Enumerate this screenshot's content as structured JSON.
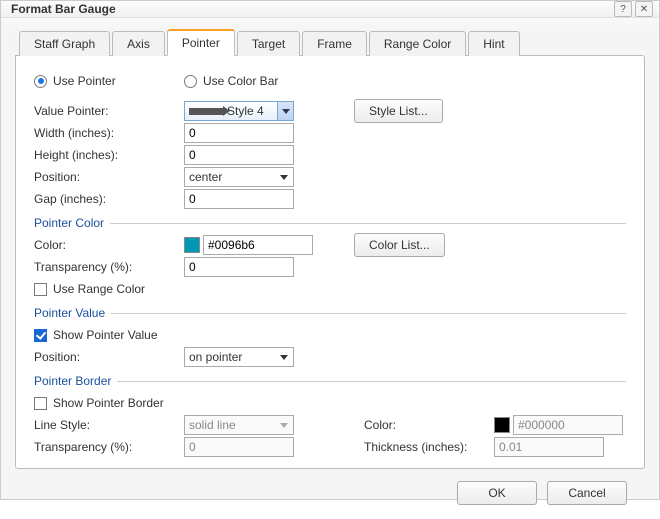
{
  "title": "Format Bar Gauge",
  "tabs": [
    "Staff Graph",
    "Axis",
    "Pointer",
    "Target",
    "Frame",
    "Range Color",
    "Hint"
  ],
  "activeTab": 2,
  "radio": {
    "usePointer": "Use Pointer",
    "useColorBar": "Use Color Bar"
  },
  "labels": {
    "valuePointer": "Value Pointer:",
    "width": "Width (inches):",
    "height": "Height (inches):",
    "position": "Position:",
    "gap": "Gap (inches):",
    "color": "Color:",
    "transparency": "Transparency (%):",
    "useRangeColor": "Use Range Color",
    "showPointerValue": "Show Pointer Value",
    "showPointerBorder": "Show Pointer Border",
    "lineStyle": "Line Style:",
    "thickness": "Thickness (inches):"
  },
  "sections": {
    "pointerColor": "Pointer Color",
    "pointerValue": "Pointer Value",
    "pointerBorder": "Pointer Border"
  },
  "buttons": {
    "styleList": "Style List...",
    "colorList": "Color List...",
    "ok": "OK",
    "cancel": "Cancel"
  },
  "values": {
    "styleName": "Style 4",
    "width": "0",
    "height": "0",
    "position": "center",
    "gap": "0",
    "colorHex": "#0096b6",
    "colorTransparency": "0",
    "valuePosition": "on pointer",
    "lineStyle": "solid line",
    "borderColor": "#000000",
    "borderTransparency": "0",
    "thickness": "0.01"
  },
  "state": {
    "usePointerChecked": true,
    "useRangeColorChecked": false,
    "showPointerValueChecked": true,
    "showPointerBorderChecked": false
  }
}
